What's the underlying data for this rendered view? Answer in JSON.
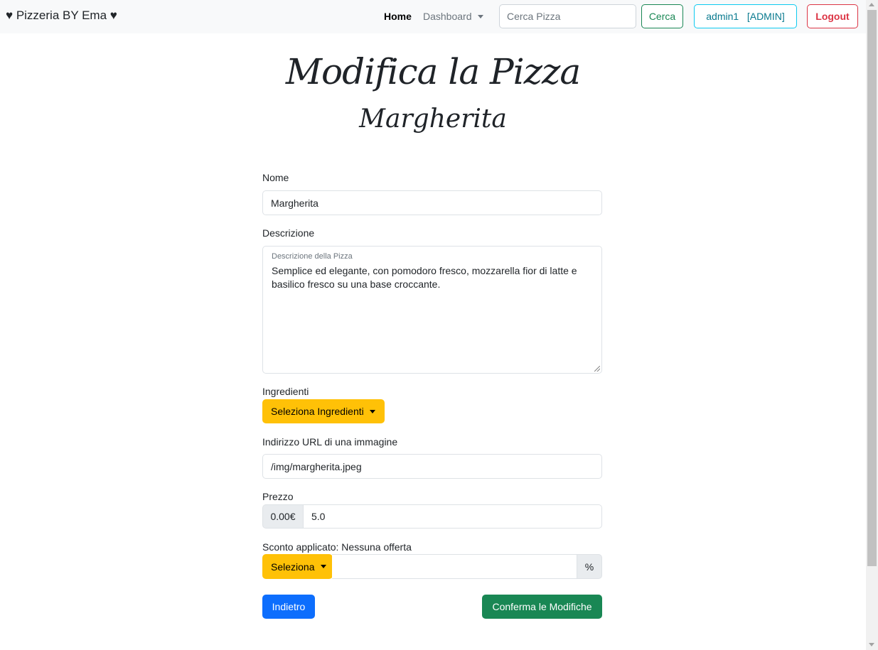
{
  "navbar": {
    "brand": "♥ Pizzeria BY Ema ♥",
    "home": "Home",
    "dashboard": "Dashboard",
    "search_placeholder": "Cerca Pizza",
    "search_button": "Cerca",
    "user_button": "admin1   [ADMIN]",
    "logout_button": "Logout"
  },
  "page": {
    "title": "Modifica la Pizza",
    "subtitle": "Margherita"
  },
  "form": {
    "nome_label": "Nome",
    "nome_value": "Margherita",
    "descrizione_label": "Descrizione",
    "descrizione_placeholder": "Descrizione della Pizza",
    "descrizione_value": "Semplice ed elegante, con pomodoro fresco, mozzarella fior di latte e basilico fresco su una base croccante.",
    "ingredienti_label": "Ingredienti",
    "ingredienti_button": "Seleziona Ingredienti",
    "url_label": "Indirizzo URL di una immagine",
    "url_value": "/img/margherita.jpeg",
    "prezzo_label": "Prezzo",
    "prezzo_prefix": "0.00€",
    "prezzo_value": "5.0",
    "sconto_label": "Sconto applicato: Nessuna offerta",
    "sconto_button": "Seleziona",
    "sconto_value": "",
    "sconto_suffix": "%",
    "back_button": "Indietro",
    "confirm_button": "Conferma le Modifiche"
  },
  "colors": {
    "warning": "#ffc107",
    "primary": "#0d6efd",
    "success": "#198754",
    "danger": "#dc3545",
    "info": "#0dcaf0"
  }
}
